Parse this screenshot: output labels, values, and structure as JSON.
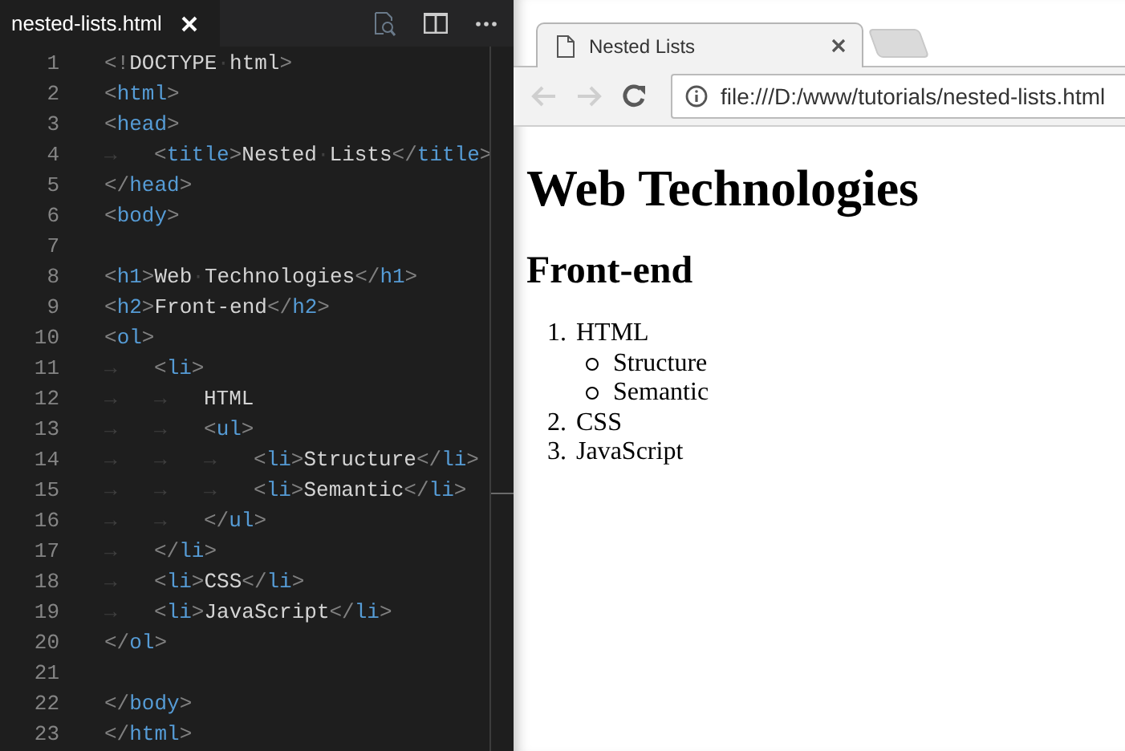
{
  "editor": {
    "tab": {
      "label": "nested-lists.html"
    },
    "lines": [
      {
        "number": "1",
        "tokens": [
          {
            "kind": "punct",
            "text": "<!"
          },
          {
            "kind": "text",
            "text": "DOCTYPE"
          },
          {
            "kind": "space",
            "text": "·"
          },
          {
            "kind": "text",
            "text": "html"
          },
          {
            "kind": "punct",
            "text": ">"
          }
        ]
      },
      {
        "number": "2",
        "tokens": [
          {
            "kind": "punct",
            "text": "<"
          },
          {
            "kind": "tag",
            "text": "html"
          },
          {
            "kind": "punct",
            "text": ">"
          }
        ]
      },
      {
        "number": "3",
        "tokens": [
          {
            "kind": "punct",
            "text": "<"
          },
          {
            "kind": "tag",
            "text": "head"
          },
          {
            "kind": "punct",
            "text": ">"
          }
        ]
      },
      {
        "number": "4",
        "tokens": [
          {
            "kind": "tab",
            "text": "→"
          },
          {
            "kind": "punct",
            "text": "<"
          },
          {
            "kind": "tag",
            "text": "title"
          },
          {
            "kind": "punct",
            "text": ">"
          },
          {
            "kind": "text",
            "text": "Nested"
          },
          {
            "kind": "space",
            "text": "·"
          },
          {
            "kind": "text",
            "text": "Lists"
          },
          {
            "kind": "punct",
            "text": "</"
          },
          {
            "kind": "tag",
            "text": "title"
          },
          {
            "kind": "punct",
            "text": ">"
          }
        ]
      },
      {
        "number": "5",
        "tokens": [
          {
            "kind": "punct",
            "text": "</"
          },
          {
            "kind": "tag",
            "text": "head"
          },
          {
            "kind": "punct",
            "text": ">"
          }
        ]
      },
      {
        "number": "6",
        "tokens": [
          {
            "kind": "punct",
            "text": "<"
          },
          {
            "kind": "tag",
            "text": "body"
          },
          {
            "kind": "punct",
            "text": ">"
          }
        ]
      },
      {
        "number": "7"
      },
      {
        "number": "8",
        "tokens": [
          {
            "kind": "punct",
            "text": "<"
          },
          {
            "kind": "tag",
            "text": "h1"
          },
          {
            "kind": "punct",
            "text": ">"
          },
          {
            "kind": "text",
            "text": "Web"
          },
          {
            "kind": "space",
            "text": "·"
          },
          {
            "kind": "text",
            "text": "Technologies"
          },
          {
            "kind": "punct",
            "text": "</"
          },
          {
            "kind": "tag",
            "text": "h1"
          },
          {
            "kind": "punct",
            "text": ">"
          }
        ]
      },
      {
        "number": "9",
        "tokens": [
          {
            "kind": "punct",
            "text": "<"
          },
          {
            "kind": "tag",
            "text": "h2"
          },
          {
            "kind": "punct",
            "text": ">"
          },
          {
            "kind": "text",
            "text": "Front-end"
          },
          {
            "kind": "punct",
            "text": "</"
          },
          {
            "kind": "tag",
            "text": "h2"
          },
          {
            "kind": "punct",
            "text": ">"
          }
        ]
      },
      {
        "number": "10",
        "tokens": [
          {
            "kind": "punct",
            "text": "<"
          },
          {
            "kind": "tag",
            "text": "ol"
          },
          {
            "kind": "punct",
            "text": ">"
          }
        ]
      },
      {
        "number": "11",
        "tokens": [
          {
            "kind": "tab",
            "text": "→"
          },
          {
            "kind": "punct",
            "text": "<"
          },
          {
            "kind": "tag",
            "text": "li"
          },
          {
            "kind": "punct",
            "text": ">"
          }
        ]
      },
      {
        "number": "12",
        "tokens": [
          {
            "kind": "tab",
            "text": "→"
          },
          {
            "kind": "tab",
            "text": "→"
          },
          {
            "kind": "text",
            "text": "HTML"
          }
        ]
      },
      {
        "number": "13",
        "tokens": [
          {
            "kind": "tab",
            "text": "→"
          },
          {
            "kind": "tab",
            "text": "→"
          },
          {
            "kind": "punct",
            "text": "<"
          },
          {
            "kind": "tag",
            "text": "ul"
          },
          {
            "kind": "punct",
            "text": ">"
          }
        ]
      },
      {
        "number": "14",
        "tokens": [
          {
            "kind": "tab",
            "text": "→"
          },
          {
            "kind": "tab",
            "text": "→"
          },
          {
            "kind": "tab",
            "text": "→"
          },
          {
            "kind": "punct",
            "text": "<"
          },
          {
            "kind": "tag",
            "text": "li"
          },
          {
            "kind": "punct",
            "text": ">"
          },
          {
            "kind": "text",
            "text": "Structure"
          },
          {
            "kind": "punct",
            "text": "</"
          },
          {
            "kind": "tag",
            "text": "li"
          },
          {
            "kind": "punct",
            "text": ">"
          }
        ]
      },
      {
        "number": "15",
        "tokens": [
          {
            "kind": "tab",
            "text": "→"
          },
          {
            "kind": "tab",
            "text": "→"
          },
          {
            "kind": "tab",
            "text": "→"
          },
          {
            "kind": "punct",
            "text": "<"
          },
          {
            "kind": "tag",
            "text": "li"
          },
          {
            "kind": "punct",
            "text": ">"
          },
          {
            "kind": "text",
            "text": "Semantic"
          },
          {
            "kind": "punct",
            "text": "</"
          },
          {
            "kind": "tag",
            "text": "li"
          },
          {
            "kind": "punct",
            "text": ">"
          }
        ]
      },
      {
        "number": "16",
        "tokens": [
          {
            "kind": "tab",
            "text": "→"
          },
          {
            "kind": "tab",
            "text": "→"
          },
          {
            "kind": "punct",
            "text": "</"
          },
          {
            "kind": "tag",
            "text": "ul"
          },
          {
            "kind": "punct",
            "text": ">"
          }
        ]
      },
      {
        "number": "17",
        "tokens": [
          {
            "kind": "tab",
            "text": "→"
          },
          {
            "kind": "punct",
            "text": "</"
          },
          {
            "kind": "tag",
            "text": "li"
          },
          {
            "kind": "punct",
            "text": ">"
          }
        ]
      },
      {
        "number": "18",
        "tokens": [
          {
            "kind": "tab",
            "text": "→"
          },
          {
            "kind": "punct",
            "text": "<"
          },
          {
            "kind": "tag",
            "text": "li"
          },
          {
            "kind": "punct",
            "text": ">"
          },
          {
            "kind": "text",
            "text": "CSS"
          },
          {
            "kind": "punct",
            "text": "</"
          },
          {
            "kind": "tag",
            "text": "li"
          },
          {
            "kind": "punct",
            "text": ">"
          }
        ]
      },
      {
        "number": "19",
        "tokens": [
          {
            "kind": "tab",
            "text": "→"
          },
          {
            "kind": "punct",
            "text": "<"
          },
          {
            "kind": "tag",
            "text": "li"
          },
          {
            "kind": "punct",
            "text": ">"
          },
          {
            "kind": "text",
            "text": "JavaScript"
          },
          {
            "kind": "punct",
            "text": "</"
          },
          {
            "kind": "tag",
            "text": "li"
          },
          {
            "kind": "punct",
            "text": ">"
          }
        ]
      },
      {
        "number": "20",
        "tokens": [
          {
            "kind": "punct",
            "text": "</"
          },
          {
            "kind": "tag",
            "text": "ol"
          },
          {
            "kind": "punct",
            "text": ">"
          }
        ]
      },
      {
        "number": "21"
      },
      {
        "number": "22",
        "tokens": [
          {
            "kind": "punct",
            "text": "</"
          },
          {
            "kind": "tag",
            "text": "body"
          },
          {
            "kind": "punct",
            "text": ">"
          }
        ]
      },
      {
        "number": "23",
        "tokens": [
          {
            "kind": "punct",
            "text": "</"
          },
          {
            "kind": "tag",
            "text": "html"
          },
          {
            "kind": "punct",
            "text": ">"
          }
        ]
      }
    ]
  },
  "browser": {
    "tab": {
      "title": "Nested Lists"
    },
    "nav_buttons": [
      {
        "kind": "back",
        "disabled": true
      },
      {
        "kind": "forward",
        "disabled": true
      },
      {
        "kind": "reload",
        "disabled": false
      }
    ],
    "address": "file:///D:/www/tutorials/nested-lists.html",
    "page": {
      "h1": "Web Technologies",
      "h2": "Front-end",
      "list": [
        {
          "marker": "1.",
          "text": "HTML",
          "children": [
            {
              "text": "Structure"
            },
            {
              "text": "Semantic"
            }
          ]
        },
        {
          "marker": "2.",
          "text": "CSS"
        },
        {
          "marker": "3.",
          "text": "JavaScript"
        }
      ]
    }
  }
}
